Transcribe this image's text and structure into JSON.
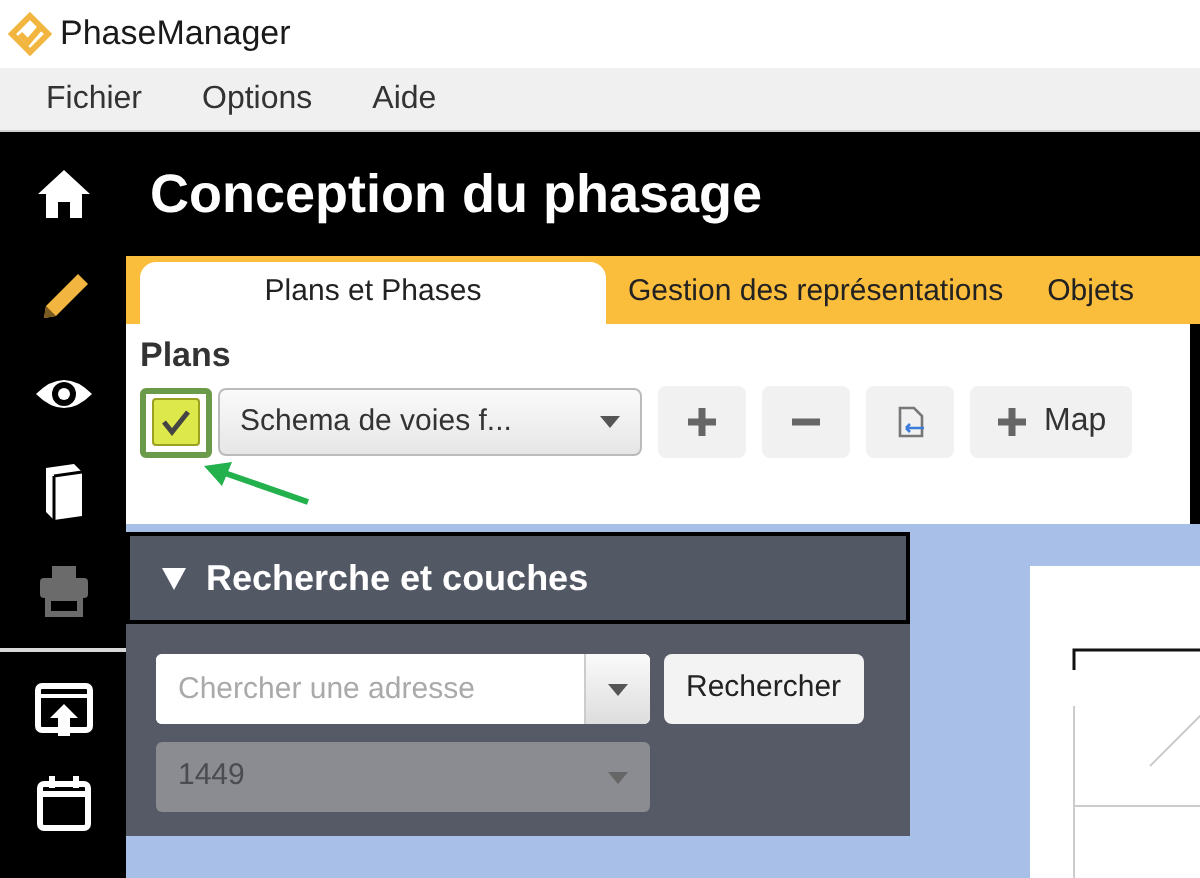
{
  "window": {
    "title": "PhaseManager"
  },
  "menu": [
    "Fichier",
    "Options",
    "Aide"
  ],
  "sidebar": {
    "items": [
      {
        "kind": "home",
        "disabled": false
      },
      {
        "kind": "pencil",
        "disabled": false
      },
      {
        "kind": "eye",
        "disabled": false
      },
      {
        "kind": "book",
        "disabled": false
      },
      {
        "kind": "printer",
        "disabled": true
      },
      {
        "kind": "export",
        "disabled": false
      },
      {
        "kind": "calendar",
        "disabled": false
      }
    ]
  },
  "header": "Conception du phasage",
  "tabs": [
    {
      "label": "Plans et Phases",
      "selected": true
    },
    {
      "label": "Gestion des représentations",
      "selected": false
    },
    {
      "label": "Objets",
      "selected": false
    }
  ],
  "plans": {
    "title": "Plans",
    "checkbox": {
      "checked": true
    },
    "dropdown": {
      "value": "Schema de voies f..."
    },
    "buttons": [
      {
        "kind": "add"
      },
      {
        "kind": "remove"
      },
      {
        "kind": "import"
      },
      {
        "kind": "add",
        "label": "Map"
      }
    ]
  },
  "search_panel": {
    "title": "Recherche et couches",
    "expanded": true,
    "address": {
      "placeholder": "Chercher une adresse"
    },
    "search_button": "Rechercher",
    "number": {
      "value": "1449",
      "disabled": true
    }
  }
}
